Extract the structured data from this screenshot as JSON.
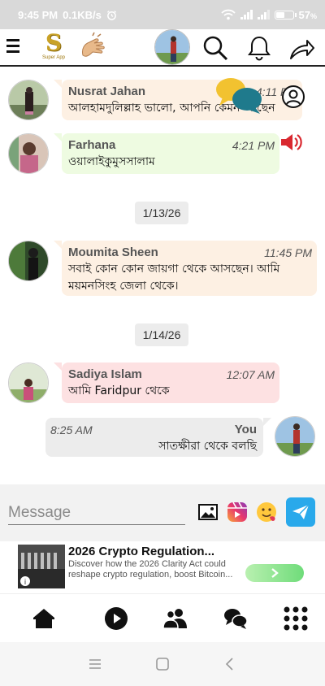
{
  "status_bar": {
    "time": "9:45 PM",
    "net_speed": "0.1KB/s",
    "battery": "57",
    "battery_unit": "%",
    "battery_level": 0.57
  },
  "app_bar": {
    "logo_letter": "S",
    "logo_caption": "Super App"
  },
  "messages": [
    {
      "name": "Nusrat Jahan",
      "time": "4:11 PM",
      "text": "আলহামদুলিল্লাহ ভালো, আপনি কেমন আছেন",
      "color": "#fdf0e3"
    },
    {
      "name": "Farhana",
      "time": "4:21 PM",
      "text": "ওয়ালাইকুমুসসালাম",
      "color": "#eefbe1"
    },
    {
      "name": "Moumita Sheen",
      "time": "11:45 PM",
      "text": "সবাই কোন কোন জায়গা থেকে আসছেন। আমি ময়মনসিংহ জেলা থেকে।",
      "color": "#fdf0e3"
    },
    {
      "name": "Sadiya Islam",
      "time": "12:07 AM",
      "text": "আমি Faridpur থেকে",
      "color": "#fde1e2"
    },
    {
      "name": "You",
      "time": "8:25 AM",
      "text": "সাতক্ষীরা থেকে বলছি",
      "color": "#ececec"
    }
  ],
  "date_separators": [
    "1/13/26",
    "1/14/26"
  ],
  "composer": {
    "placeholder": "Message"
  },
  "ad": {
    "title": "2026 Crypto Regulation...",
    "description": "Discover how the 2026 Clarity Act could reshape crypto regulation, boost Bitcoin..."
  },
  "colors": {
    "send_button": "#29a9eb",
    "speaker_icon": "#d9282f",
    "app_bar_border": "#222222"
  },
  "icons": {
    "menu": "menu-icon",
    "search": "search-icon",
    "bell": "bell-icon",
    "share": "share-icon",
    "home": "home-icon",
    "play": "play-icon",
    "users": "users-icon",
    "chat": "chat-icon",
    "apps": "grid-icon"
  }
}
